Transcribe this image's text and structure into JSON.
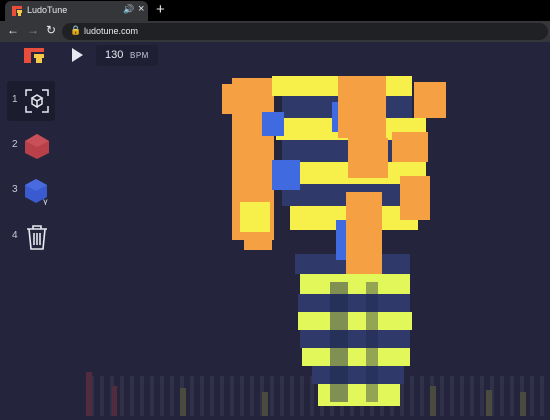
{
  "browser": {
    "tab_title": "LudoTune",
    "tab_audio_icon": "speaker-icon",
    "tab_close_icon": "close-icon",
    "new_tab_icon": "plus-icon",
    "back_icon": "back-arrow-icon",
    "forward_icon": "forward-arrow-icon",
    "reload_icon": "reload-icon",
    "lock_icon": "lock-icon",
    "url": "ludotune.com"
  },
  "app": {
    "logo_icon": "ludotune-logo-icon",
    "play_icon": "play-icon",
    "bpm_value": "130",
    "bpm_unit": "BPM",
    "tools": [
      {
        "number": "1",
        "icon": "rotate-view-icon",
        "selected": true
      },
      {
        "number": "2",
        "icon": "red-cube-icon",
        "selected": false
      },
      {
        "number": "3",
        "icon": "blue-cube-icon",
        "selected": false
      },
      {
        "number": "4",
        "icon": "trash-icon",
        "selected": false
      }
    ],
    "colors": {
      "background": "#24253c",
      "orange": "#f5a042",
      "yellow": "#f7f04a",
      "lime": "#e2f75a",
      "navy": "#2f3a6b",
      "blue": "#3f6ae0",
      "red": "#b84048"
    }
  }
}
